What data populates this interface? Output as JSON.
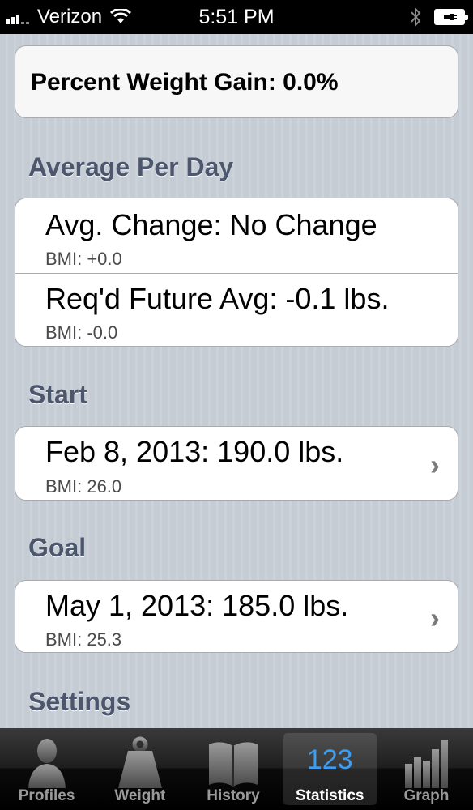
{
  "status_bar": {
    "carrier": "Verizon",
    "time": "5:51 PM"
  },
  "percent_weight_gain": "Percent Weight Gain: 0.0%",
  "average_per_day": {
    "header": "Average Per Day",
    "avg_change": {
      "main": "Avg. Change: No Change",
      "bmi": "BMI: +0.0"
    },
    "reqd_future": {
      "main": "Req'd Future Avg: -0.1 lbs.",
      "bmi": "BMI: -0.0"
    }
  },
  "start": {
    "header": "Start",
    "main": "Feb 8, 2013: 190.0 lbs.",
    "bmi": "BMI: 26.0"
  },
  "goal": {
    "header": "Goal",
    "main": "May 1, 2013: 185.0 lbs.",
    "bmi": "BMI: 25.3"
  },
  "settings": {
    "header": "Settings"
  },
  "tabs": [
    {
      "label": "Profiles",
      "icon": "person-icon"
    },
    {
      "label": "Weight",
      "icon": "weight-icon"
    },
    {
      "label": "History",
      "icon": "book-icon"
    },
    {
      "label": "Statistics",
      "icon": "123-icon",
      "icon_text": "123",
      "selected": true
    },
    {
      "label": "Graph",
      "icon": "bar-graph-icon"
    }
  ],
  "colors": {
    "background": "#c5ccd4",
    "section_header": "#4c566c",
    "tab_selected_icon": "#3a9ef5"
  }
}
